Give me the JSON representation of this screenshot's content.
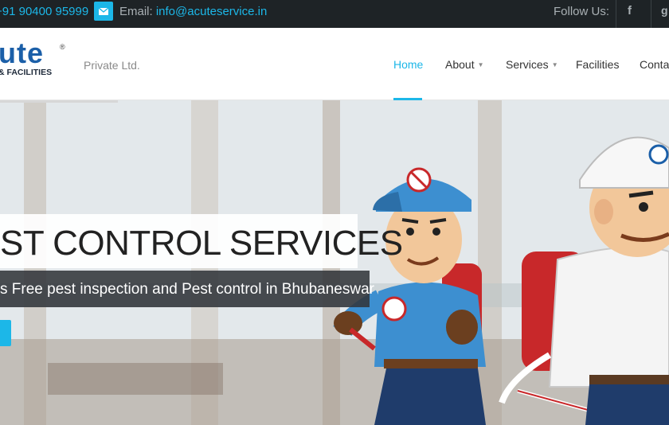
{
  "topbar": {
    "phone": "+91 90400 95999",
    "email_label": "Email: ",
    "email_value": "info@acuteservice.in",
    "follow_label": "Follow Us:",
    "social": {
      "facebook": "f",
      "googleplus": "g"
    }
  },
  "header": {
    "logo_word": "ute",
    "logo_reg": "®",
    "logo_sub": "& FACILITIES",
    "tagline": "Private Ltd.",
    "nav": {
      "home": "Home",
      "about": "About",
      "services": "Services",
      "facilities": "Facilities",
      "contact": "Contac"
    },
    "caret": "▼"
  },
  "hero": {
    "title": "ST CONTROL SERVICES",
    "subtitle": "s Free pest inspection and Pest control in Bhubaneswar"
  },
  "colors": {
    "accent": "#1cb7e8",
    "topbar_bg": "#1e2326",
    "logo_blue": "#1b5fa8"
  },
  "icons": [
    "mail-icon",
    "facebook-icon",
    "googleplus-icon",
    "caret-down-icon"
  ]
}
